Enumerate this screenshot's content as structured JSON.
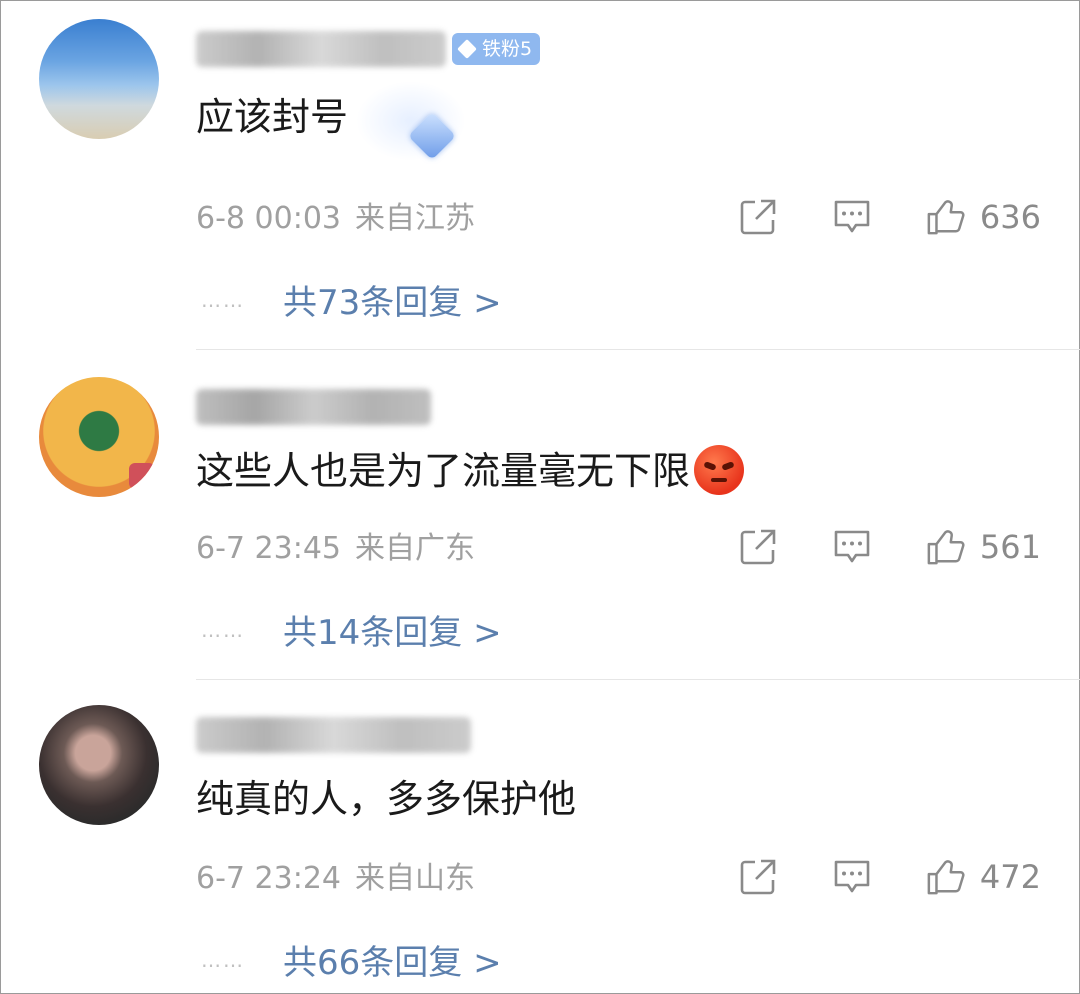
{
  "comments": [
    {
      "username": "",
      "badge": "铁粉5",
      "text": "应该封号",
      "date": "6-8 00:03",
      "location": "来自江苏",
      "likes": "636",
      "replies_label": "共73条回复 >",
      "avatar_colors": [
        "#3a7fd0",
        "#9cc5ec",
        "#d9cdb2"
      ]
    },
    {
      "username": "",
      "text": "这些人也是为了流量毫无下限",
      "date": "6-7 23:45",
      "location": "来自广东",
      "likes": "561",
      "replies_label": "共14条回复 >",
      "avatar_colors": [
        "#f2b64a",
        "#2e7a44",
        "#d0505a"
      ]
    },
    {
      "username": "",
      "text": "纯真的人，多多保护他",
      "date": "6-7 23:24",
      "location": "来自山东",
      "likes": "472",
      "replies_label": "共66条回复 >",
      "avatar_colors": [
        "#6d5a55",
        "#c9a49a",
        "#2b2b2b"
      ]
    }
  ],
  "dots": "……",
  "icons": {
    "share": "share-icon",
    "reply": "comment-icon",
    "like": "thumbs-up-icon",
    "badge": "diamond-icon",
    "emoji": "angry-face-icon"
  },
  "colors": {
    "reply_link": "#5b7fad",
    "meta": "#a0a0a0",
    "badge_bg": "#8fb8ef"
  }
}
